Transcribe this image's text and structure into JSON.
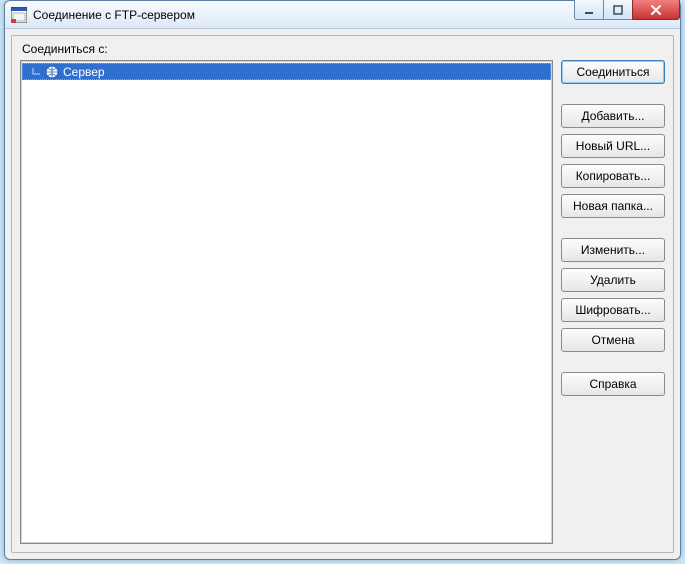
{
  "window": {
    "title": "Соединение с FTP-сервером"
  },
  "labels": {
    "connect_to": "Соединиться с:"
  },
  "tree": {
    "items": [
      {
        "label": "Сервер",
        "selected": true
      }
    ]
  },
  "buttons": {
    "connect": "Соединиться",
    "add": "Добавить...",
    "new_url": "Новый URL...",
    "copy": "Копировать...",
    "new_folder": "Новая папка...",
    "edit": "Изменить...",
    "delete": "Удалить",
    "encrypt": "Шифровать...",
    "cancel": "Отмена",
    "help": "Справка"
  }
}
